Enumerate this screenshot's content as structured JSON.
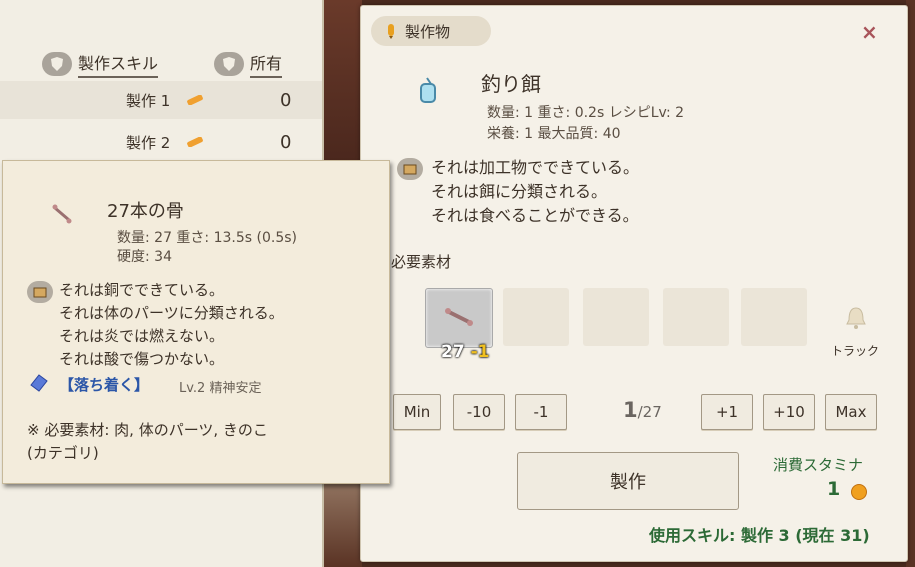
{
  "skill_panel": {
    "header_skill": "製作スキル",
    "header_owned": "所有",
    "rows": [
      {
        "name": "製作 1",
        "value": "0"
      },
      {
        "name": "製作 2",
        "value": "0"
      }
    ]
  },
  "craft_panel": {
    "tab_label": "製作物",
    "close_label": "×",
    "item": {
      "title": "釣り餌",
      "line1": "数量: 1  重さ: 0.2s  レシピLv: 2",
      "line2": "栄養: 1  最大品質: 40"
    },
    "properties": [
      "それは加工物でできている。",
      "それは餌に分類される。",
      "それは食べることができる。"
    ],
    "required_label": "必要素材",
    "slot_qty": "27",
    "slot_dec": "-1",
    "track_label": "トラック",
    "buttons": {
      "min": "Min",
      "minus10": "-10",
      "minus1": "-1",
      "plus1": "+1",
      "plus10": "+10",
      "max": "Max"
    },
    "count_current": "1",
    "count_total": "/27",
    "craft_button": "製作",
    "stamina_label": "消費スタミナ",
    "stamina_value": "1",
    "skill_used": "使用スキル: 製作 3 (現在 31)"
  },
  "tooltip": {
    "title": "27本の骨",
    "line1": "数量: 27  重さ: 13.5s (0.5s)",
    "line2": "硬度: 34",
    "properties": [
      "それは銅でできている。",
      "それは体のパーツに分類される。",
      "それは炎では燃えない。",
      "それは酸で傷つかない。"
    ],
    "trait": "【落ち着く】",
    "trait_sub": "Lv.2 精神安定",
    "note_line1": "※ 必要素材: 肉, 体のパーツ, きのこ",
    "note_line2": "(カテゴリ)"
  },
  "colors": {
    "panel_bg": "#f5f1e8",
    "tooltip_bg": "#f3ecdc",
    "accent_green": "#2c6a36",
    "trait_blue": "#2b56a8",
    "close_red": "#a8545a"
  }
}
